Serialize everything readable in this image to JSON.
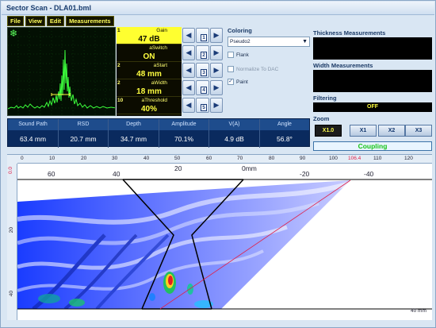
{
  "window": {
    "title": "Sector Scan - DLA01.bml"
  },
  "menu": [
    "File",
    "View",
    "Edit",
    "Measurements"
  ],
  "ascan": {
    "icon": "snowflake-icon"
  },
  "params": [
    {
      "num": "1",
      "label": "Gain",
      "value": "47 dB",
      "key": "1",
      "active": true
    },
    {
      "num": "",
      "label": "aSwitch",
      "value": "ON",
      "key": "2",
      "active": false
    },
    {
      "num": "2",
      "label": "aStart",
      "value": "48 mm",
      "key": "3",
      "active": false
    },
    {
      "num": "2",
      "label": "aWidth",
      "value": "18 mm",
      "key": "4",
      "active": false
    },
    {
      "num": "10",
      "label": "aThreshold",
      "value": "40%",
      "key": "5",
      "active": false
    }
  ],
  "coloring": {
    "label": "Coloring",
    "palette": "Pseudo2",
    "flank": "Flank",
    "normalize": "Normalize To DAC",
    "paint": "Paint"
  },
  "side": {
    "thickness_label": "Thickness Measurements",
    "width_label": "Width Measurements",
    "filtering_label": "Filtering",
    "filtering_value": "OFF"
  },
  "measurements": {
    "headers": [
      "Sound Path",
      "RSD",
      "Depth",
      "Amplitude",
      "V(A)",
      "Angle"
    ],
    "values": [
      "63.4 mm",
      "20.7 mm",
      "34.7 mm",
      "70.1%",
      "4.9 dB",
      "56.8°"
    ]
  },
  "zoom": {
    "label": "Zoom",
    "buttons": [
      "X1.0",
      "X1",
      "X2",
      "X3"
    ],
    "status": "Coupling"
  },
  "scan": {
    "top_ruler": [
      "0",
      "10",
      "20",
      "30",
      "40",
      "50",
      "60",
      "70",
      "80",
      "90",
      "100",
      "106.4",
      "110",
      "120"
    ],
    "left_ruler": [
      "0.0",
      "20",
      "40"
    ],
    "axis_labels": [
      "60",
      "40",
      "20",
      "0mm",
      "-20",
      "-40"
    ],
    "corner_label": "40 mm"
  },
  "colors": {
    "active_param": "#ffff30",
    "coupling": "#16c516",
    "cursor": "#e0204a"
  }
}
